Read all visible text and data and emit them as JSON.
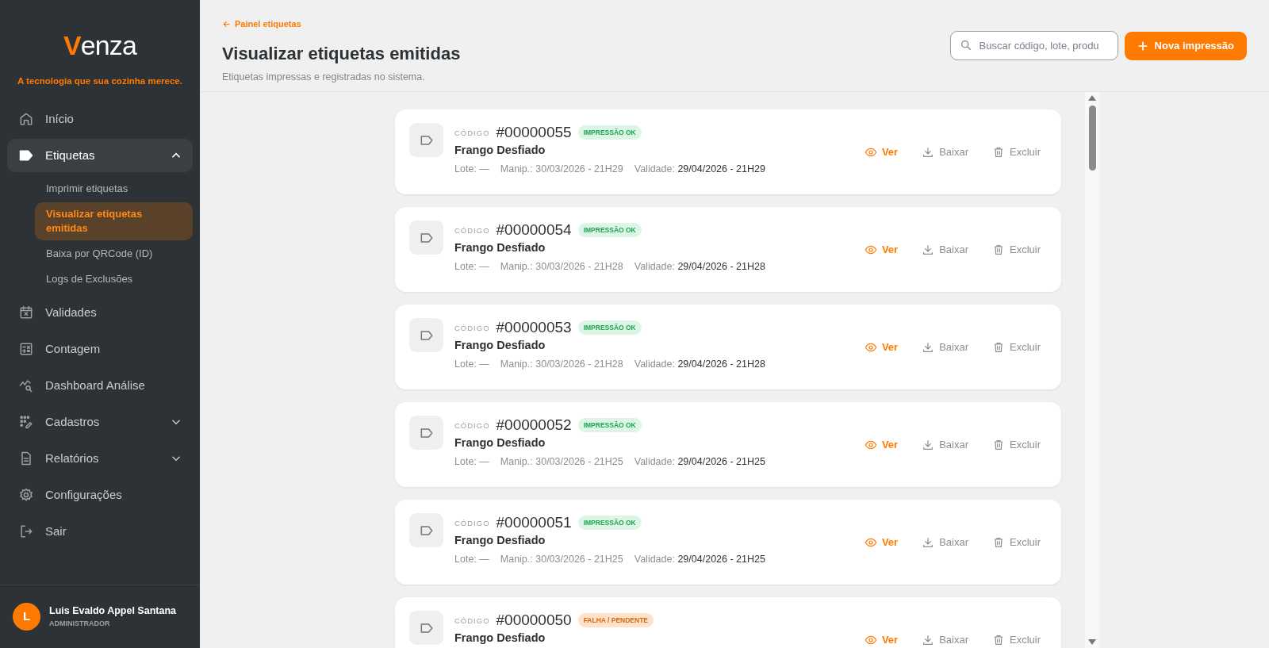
{
  "sidebar": {
    "logo": "Venza",
    "tagline": "A tecnologia que sua cozinha merece.",
    "items": [
      {
        "label": "Início",
        "selected": false
      },
      {
        "label": "Etiquetas",
        "selected": false,
        "expanded": true,
        "children": [
          {
            "label": "Imprimir etiquetas",
            "selected": false
          },
          {
            "label": "Visualizar etiquetas emitidas",
            "selected": true
          },
          {
            "label": "Baixa por QRCode (ID)",
            "selected": false
          },
          {
            "label": "Logs de Exclusões",
            "selected": false
          }
        ]
      },
      {
        "label": "Validades",
        "selected": false
      },
      {
        "label": "Contagem",
        "selected": false
      },
      {
        "label": "Dashboard Análise",
        "selected": false
      },
      {
        "label": "Cadastros",
        "selected": false,
        "expanded": false
      },
      {
        "label": "Relatórios",
        "selected": false,
        "expanded": false
      },
      {
        "label": "Configurações",
        "selected": false
      },
      {
        "label": "Sair",
        "selected": false
      }
    ],
    "user": {
      "initial": "L",
      "name": "Luis Evaldo Appel Santana",
      "role": "ADMINISTRADOR"
    }
  },
  "header": {
    "back_link": "Painel etiquetas",
    "title": "Visualizar etiquetas emitidas",
    "subtitle": "Etiquetas impressas e registradas no sistema.",
    "search": {
      "placeholder": "Buscar código, lote, produ"
    },
    "new_button": "Nova impressão"
  },
  "labels": [
    {
      "code_label": "CÓDIGO",
      "code": "#00000055",
      "status": {
        "kind": "ok",
        "text": "IMPRESSÃO OK"
      },
      "product": "Frango Desfiado",
      "lote_label": "Lote:",
      "lote": "—",
      "manip_label": "Manip.:",
      "manip": "30/03/2026 - 21H29",
      "validade_label": "Validade:",
      "validade": "29/04/2026 - 21H29",
      "actions": [
        "Ver",
        "Baixar",
        "Excluir"
      ]
    },
    {
      "code_label": "CÓDIGO",
      "code": "#00000054",
      "status": {
        "kind": "ok",
        "text": "IMPRESSÃO OK"
      },
      "product": "Frango Desfiado",
      "lote_label": "Lote:",
      "lote": "—",
      "manip_label": "Manip.:",
      "manip": "30/03/2026 - 21H28",
      "validade_label": "Validade:",
      "validade": "29/04/2026 - 21H28",
      "actions": [
        "Ver",
        "Baixar",
        "Excluir"
      ]
    },
    {
      "code_label": "CÓDIGO",
      "code": "#00000053",
      "status": {
        "kind": "ok",
        "text": "IMPRESSÃO OK"
      },
      "product": "Frango Desfiado",
      "lote_label": "Lote:",
      "lote": "—",
      "manip_label": "Manip.:",
      "manip": "30/03/2026 - 21H28",
      "validade_label": "Validade:",
      "validade": "29/04/2026 - 21H28",
      "actions": [
        "Ver",
        "Baixar",
        "Excluir"
      ]
    },
    {
      "code_label": "CÓDIGO",
      "code": "#00000052",
      "status": {
        "kind": "ok",
        "text": "IMPRESSÃO OK"
      },
      "product": "Frango Desfiado",
      "lote_label": "Lote:",
      "lote": "—",
      "manip_label": "Manip.:",
      "manip": "30/03/2026 - 21H25",
      "validade_label": "Validade:",
      "validade": "29/04/2026 - 21H25",
      "actions": [
        "Ver",
        "Baixar",
        "Excluir"
      ]
    },
    {
      "code_label": "CÓDIGO",
      "code": "#00000051",
      "status": {
        "kind": "ok",
        "text": "IMPRESSÃO OK"
      },
      "product": "Frango Desfiado",
      "lote_label": "Lote:",
      "lote": "—",
      "manip_label": "Manip.:",
      "manip": "30/03/2026 - 21H25",
      "validade_label": "Validade:",
      "validade": "29/04/2026 - 21H25",
      "actions": [
        "Ver",
        "Baixar",
        "Excluir"
      ]
    },
    {
      "code_label": "CÓDIGO",
      "code": "#00000050",
      "status": {
        "kind": "pending",
        "text": "FALHA / PENDENTE"
      },
      "product": "Frango Desfiado",
      "actions": [
        "Ver",
        "Baixar",
        "Excluir"
      ]
    }
  ]
}
